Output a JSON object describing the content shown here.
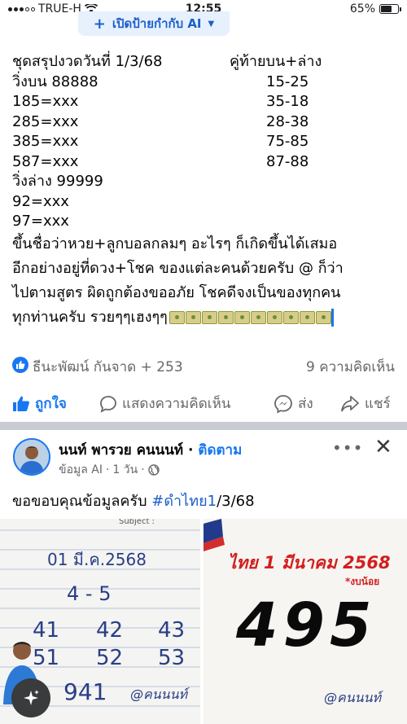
{
  "status_bar": {
    "carrier": "TRUE-H",
    "time": "12:55",
    "battery_percent": "65%",
    "battery_level": 0.65
  },
  "ai_pill": {
    "label": "เปิดป้ายกำกับ AI"
  },
  "post1": {
    "title_left": "ชุดสรุปงวดวันที่ 1/3/68",
    "title_right": "คู่ท้ายบน+ล่าง",
    "rows": [
      {
        "left": "วิ่งบน 88888",
        "right": "15-25"
      },
      {
        "left": "185=xxx",
        "right": "35-18"
      },
      {
        "left": "285=xxx",
        "right": "28-38"
      },
      {
        "left": "385=xxx",
        "right": "75-85"
      },
      {
        "left": "587=xxx",
        "right": "87-88"
      },
      {
        "left": "วิ่งล่าง 99999",
        "right": ""
      },
      {
        "left": "92=xxx",
        "right": ""
      },
      {
        "left": "97=xxx",
        "right": ""
      }
    ],
    "para_lines": [
      "ขึ้นชื่อว่าหวย+ลูกบอลกลมๆ อะไรๆ ก็เกิดขึ้นได้เสมอ",
      "อีกอย่างอยู่ที่ดวง+โชค ของแต่ละคนด้วยครับ @ ก็ว่า",
      "ไปตามสูตร ผิดถูกต้องขออภัย โชคดีจงเป็นของทุกคน",
      "ทุกท่านครับ รวยๆๆเฮงๆๆ"
    ],
    "money_emoji_count": 10,
    "reactions": {
      "names": "ธีนะพัฒน์ กันจาด + 253",
      "comments": "9 ความคิดเห็น"
    },
    "actions": {
      "like": "ถูกใจ",
      "comment": "แสดงความคิดเห็น",
      "share_messenger": "ส่ง",
      "share": "แชร์"
    }
  },
  "post2": {
    "author": "นนท์ พารวย คนนนท์",
    "follow": "ติดตาม",
    "meta_source": "ข้อมูล AI",
    "meta_time": "1 วัน",
    "text_before": "ขอขอบคุณข้อมูลครับ ",
    "hashtag": "#ดำไทย1",
    "text_after": "/3/68",
    "photo_left": {
      "subject_label": "Subject :",
      "date_line": "01 มี.ค.2568",
      "pair": "4 - 5",
      "row1": [
        "41",
        "42",
        "43"
      ],
      "row2": [
        "51",
        "52",
        "53"
      ],
      "bottom": "941",
      "signature": "@คนนนท์"
    },
    "photo_right": {
      "headline": "ไทย 1 มีนาคม 2568",
      "sub": "*งบน้อย",
      "number": "495",
      "signature": "@คนนนท์"
    }
  },
  "colors": {
    "accent": "#1877f2",
    "pill_bg": "#e7f0fd",
    "muted": "#65676b",
    "divider": "#c9ccd1"
  }
}
